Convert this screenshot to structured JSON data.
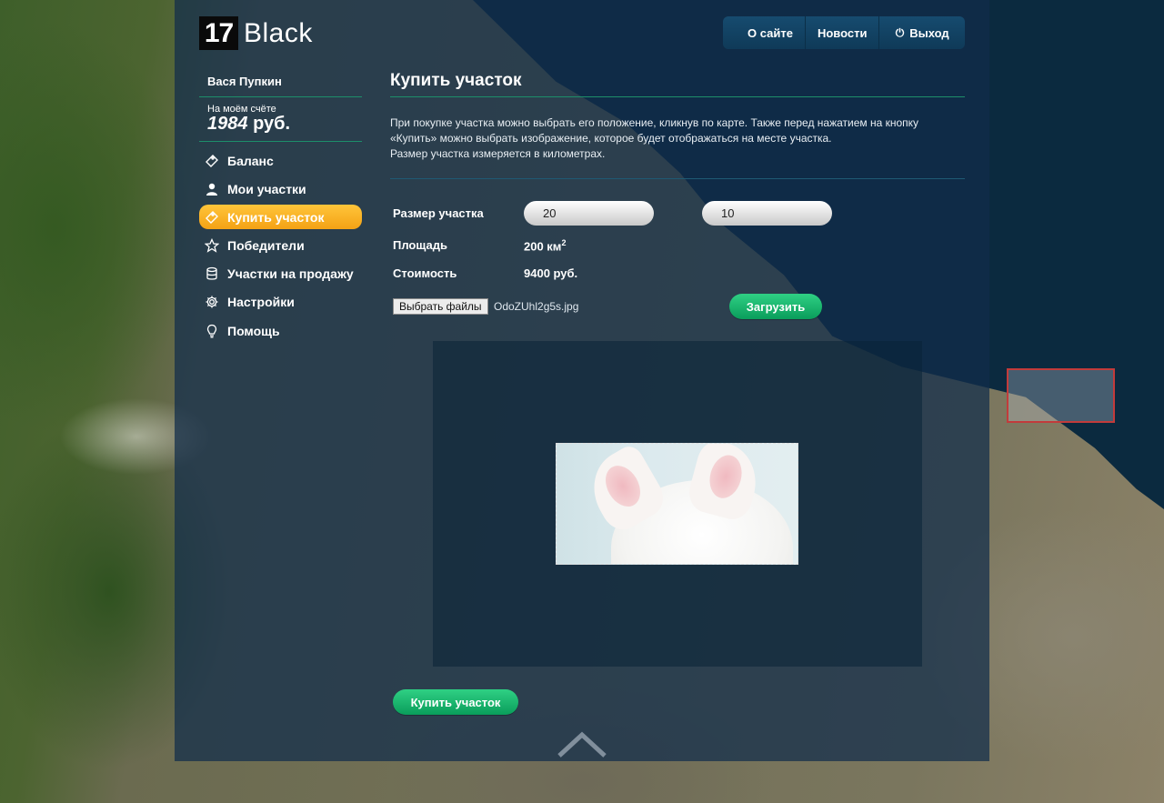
{
  "header": {
    "logo_number": "17",
    "logo_word": "Black",
    "nav": [
      {
        "label": "О сайте",
        "icon": ""
      },
      {
        "label": "Новости",
        "icon": ""
      },
      {
        "label": "Выход",
        "icon": "power-icon"
      }
    ]
  },
  "sidebar": {
    "user_name": "Вася Пупкин",
    "account_label": "На моём счёте",
    "account_value": "1984",
    "account_currency": "руб.",
    "items": [
      {
        "label": "Баланс",
        "icon": "ticket-icon",
        "active": false
      },
      {
        "label": "Мои участки",
        "icon": "user-icon",
        "active": false
      },
      {
        "label": "Купить участок",
        "icon": "ticket-icon",
        "active": true
      },
      {
        "label": "Победители",
        "icon": "star-icon",
        "active": false
      },
      {
        "label": "Участки на продажу",
        "icon": "database-icon",
        "active": false
      },
      {
        "label": "Настройки",
        "icon": "gear-icon",
        "active": false
      },
      {
        "label": "Помощь",
        "icon": "lightbulb-icon",
        "active": false
      }
    ]
  },
  "main": {
    "title": "Купить участок",
    "description_lines": [
      "При покупке участка можно выбрать его положение, кликнув по карте. Также перед нажатием на кнопку",
      "«Купить» можно выбрать изображение, которое будет отображаться на месте участка.",
      "Размер участка измеряется в километрах."
    ],
    "form": {
      "size_label": "Размер участка",
      "size_x": "20",
      "size_y": "10",
      "area_label": "Площадь",
      "area_value": "200 км",
      "area_power": "2",
      "cost_label": "Стоимость",
      "cost_value": "9400 руб.",
      "file_button": "Выбрать файлы",
      "file_name": "OdoZUhl2g5s.jpg",
      "upload_button": "Загрузить"
    },
    "buy_button": "Купить участок"
  },
  "colors": {
    "accent_active": "#f4a215",
    "button_green": "#0a9d5b",
    "separator": "#1d8f6a",
    "panel": "#102d4b"
  }
}
